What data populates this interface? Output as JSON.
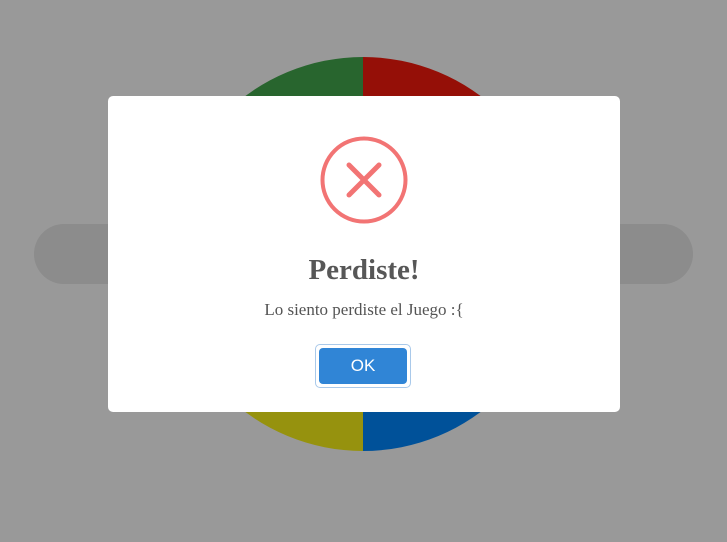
{
  "colors": {
    "quad_top_left": "#44a84e",
    "quad_top_right": "#f81a0c",
    "quad_bottom_left": "#fbf418",
    "quad_bottom_right": "#0088ff",
    "icon_red": "#f27474",
    "button_blue": "#3085d6"
  },
  "board": {
    "quadrants": [
      "green",
      "red",
      "yellow",
      "blue"
    ]
  },
  "dialog": {
    "icon": "error-x-icon",
    "title": "Perdiste!",
    "message": "Lo siento perdiste el Juego :{",
    "ok_label": "OK"
  }
}
